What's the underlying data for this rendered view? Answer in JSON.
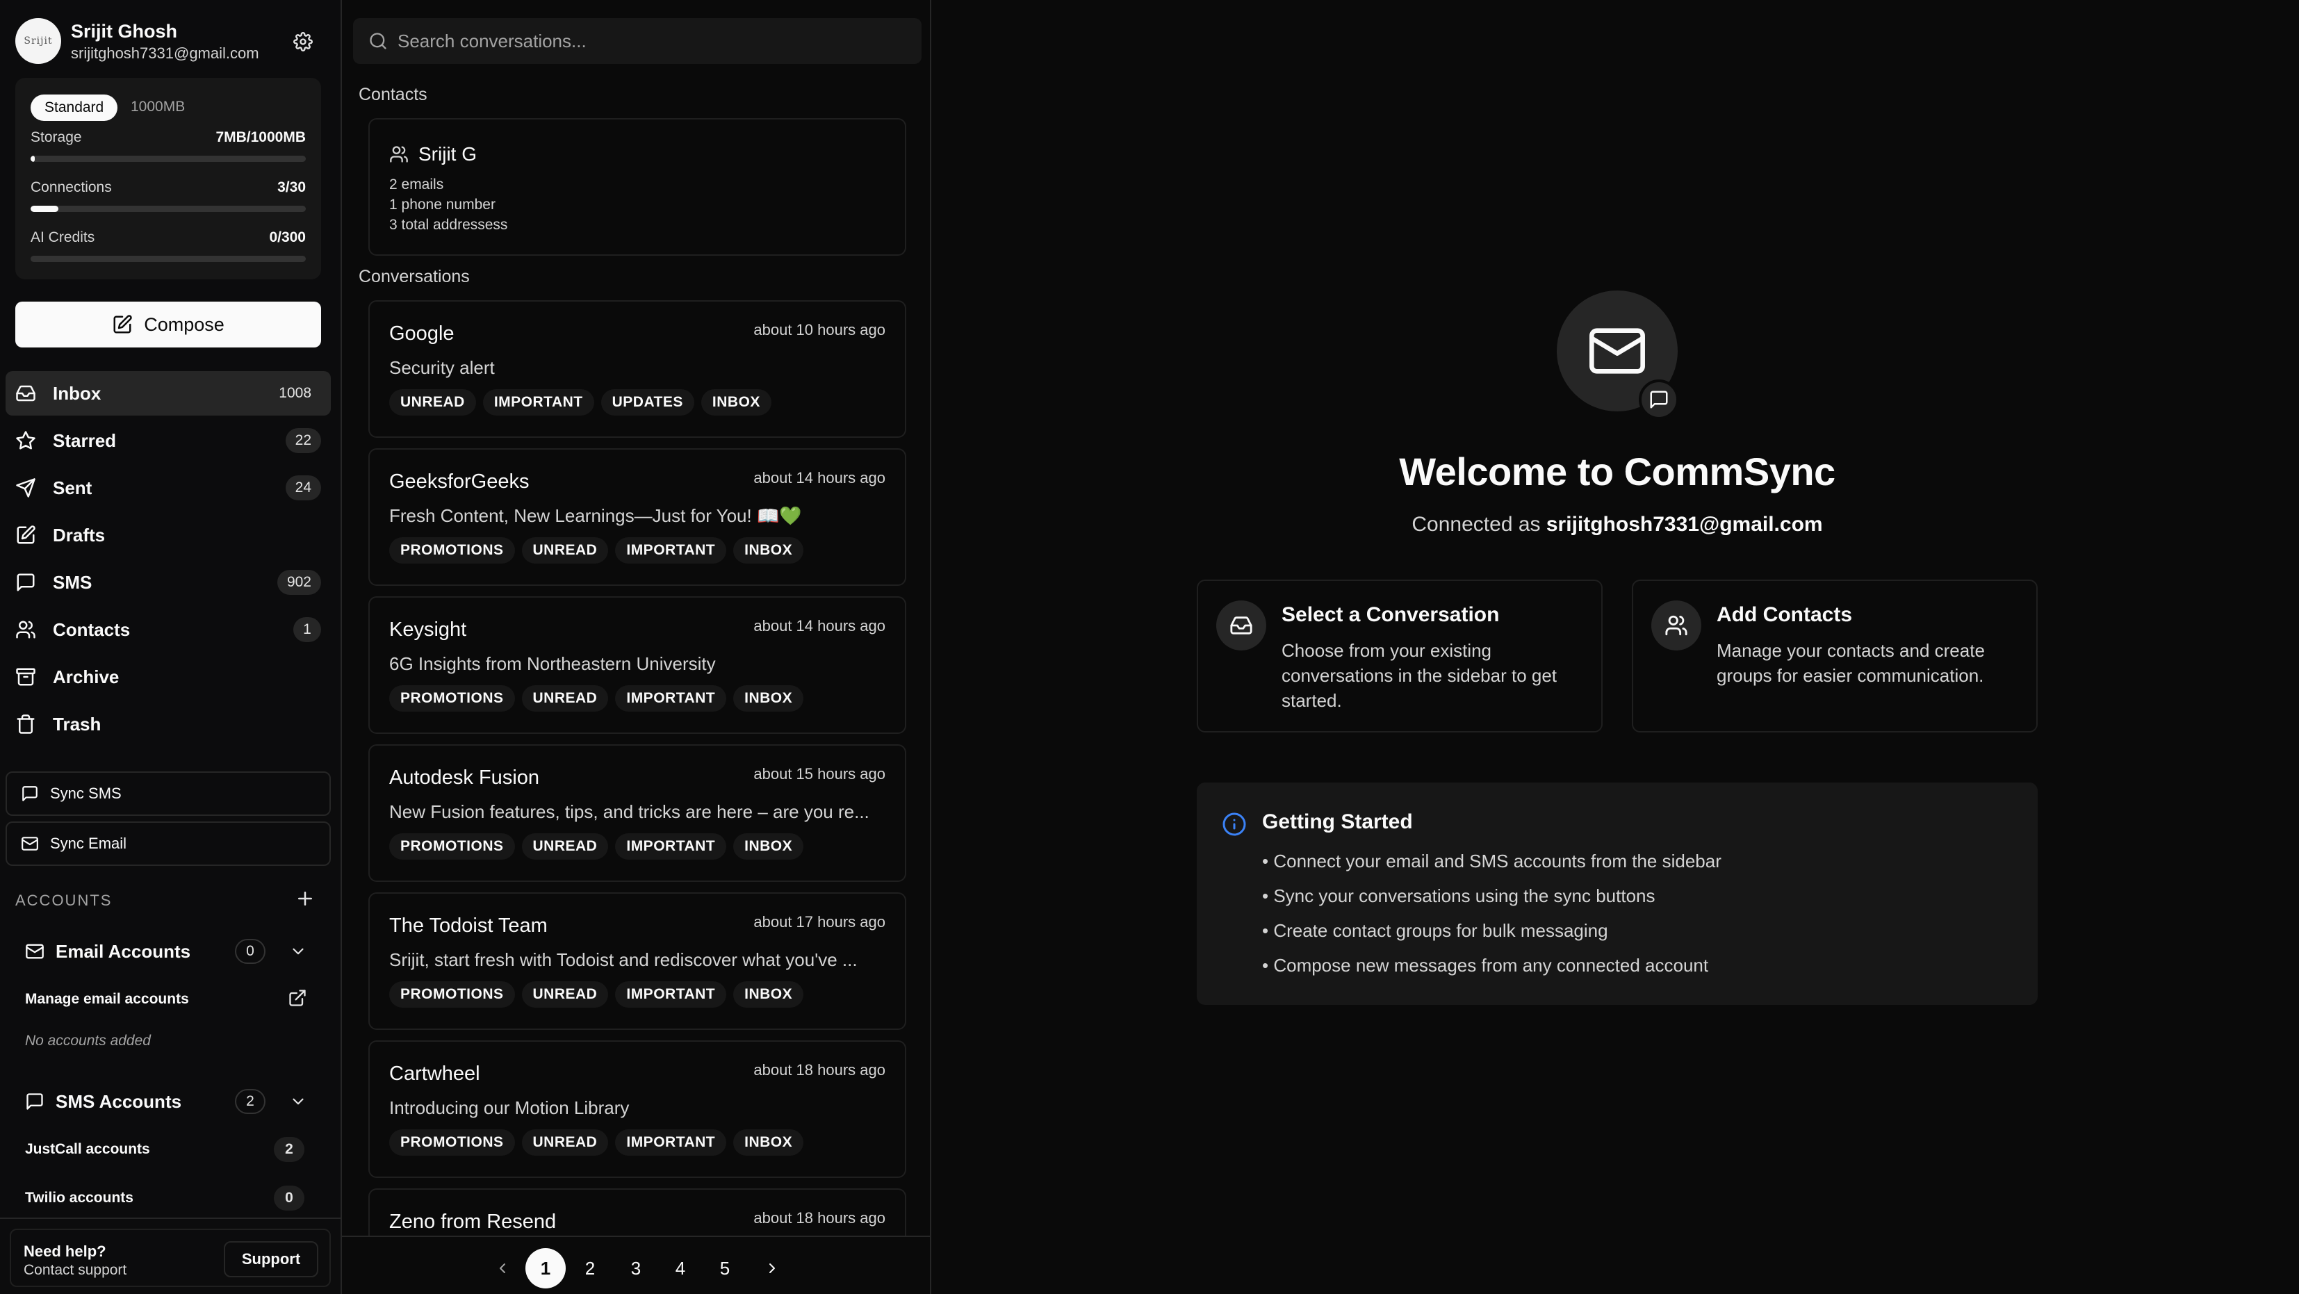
{
  "profile": {
    "name": "Srijit Ghosh",
    "email": "srijitghosh7331@gmail.com",
    "avatar_text": "Srijit"
  },
  "plan": {
    "tier": "Standard",
    "size": "1000MB",
    "storage_label": "Storage",
    "storage_value": "7MB/1000MB",
    "storage_fraction": 0.007,
    "connections_label": "Connections",
    "connections_value": "3/30",
    "connections_fraction": 0.1,
    "ai_label": "AI Credits",
    "ai_value": "0/300",
    "ai_fraction": 0
  },
  "compose_label": "Compose",
  "nav": [
    {
      "label": "Inbox",
      "count": "1008",
      "icon": "inbox-icon"
    },
    {
      "label": "Starred",
      "count": "22",
      "icon": "star-icon"
    },
    {
      "label": "Sent",
      "count": "24",
      "icon": "send-icon"
    },
    {
      "label": "Drafts",
      "count": "",
      "icon": "drafts-icon"
    },
    {
      "label": "SMS",
      "count": "902",
      "icon": "message-icon"
    },
    {
      "label": "Contacts",
      "count": "1",
      "icon": "contacts-icon"
    },
    {
      "label": "Archive",
      "count": "",
      "icon": "archive-icon"
    },
    {
      "label": "Trash",
      "count": "",
      "icon": "trash-icon"
    }
  ],
  "sync": {
    "sms": "Sync SMS",
    "email": "Sync Email"
  },
  "accounts": {
    "heading": "ACCOUNTS",
    "email_label": "Email Accounts",
    "email_count": "0",
    "manage_email": "Manage email accounts",
    "no_accounts": "No accounts added",
    "sms_label": "SMS Accounts",
    "sms_count": "2",
    "justcall_label": "JustCall accounts",
    "justcall_count": "2",
    "twilio_label": "Twilio accounts",
    "twilio_count": "0"
  },
  "help": {
    "title": "Need help?",
    "subtitle": "Contact support",
    "button": "Support"
  },
  "search": {
    "placeholder": "Search conversations..."
  },
  "contacts_heading": "Contacts",
  "contact": {
    "name": "Srijit G",
    "emails": "2 emails",
    "phones": "1 phone number",
    "addresses": "3 total addressess"
  },
  "conversations_heading": "Conversations",
  "conversations": [
    {
      "sender": "Google",
      "time": "about 10 hours ago",
      "subject": "Security alert",
      "tags": [
        "UNREAD",
        "IMPORTANT",
        "UPDATES",
        "INBOX"
      ]
    },
    {
      "sender": "GeeksforGeeks",
      "time": "about 14 hours ago",
      "subject": "Fresh Content, New Learnings—Just for You! 📖💚",
      "tags": [
        "PROMOTIONS",
        "UNREAD",
        "IMPORTANT",
        "INBOX"
      ]
    },
    {
      "sender": "Keysight",
      "time": "about 14 hours ago",
      "subject": "6G Insights from Northeastern University",
      "tags": [
        "PROMOTIONS",
        "UNREAD",
        "IMPORTANT",
        "INBOX"
      ]
    },
    {
      "sender": "Autodesk Fusion",
      "time": "about 15 hours ago",
      "subject": "New Fusion features, tips, and tricks are here – are you re...",
      "tags": [
        "PROMOTIONS",
        "UNREAD",
        "IMPORTANT",
        "INBOX"
      ]
    },
    {
      "sender": "The Todoist Team",
      "time": "about 17 hours ago",
      "subject": "Srijit, start fresh with Todoist and rediscover what you've ...",
      "tags": [
        "PROMOTIONS",
        "UNREAD",
        "IMPORTANT",
        "INBOX"
      ]
    },
    {
      "sender": "Cartwheel",
      "time": "about 18 hours ago",
      "subject": "Introducing our Motion Library",
      "tags": [
        "PROMOTIONS",
        "UNREAD",
        "IMPORTANT",
        "INBOX"
      ]
    },
    {
      "sender": "Zeno from Resend",
      "time": "about 18 hours ago",
      "subject": "",
      "tags": []
    }
  ],
  "pagination": {
    "pages": [
      "1",
      "2",
      "3",
      "4",
      "5"
    ],
    "current": "1"
  },
  "welcome": {
    "title": "Welcome to CommSync",
    "connected_prefix": "Connected as",
    "connected_email": "srijitghosh7331@gmail.com"
  },
  "cards": [
    {
      "title": "Select a Conversation",
      "desc": "Choose from your existing conversations in the sidebar to get started."
    },
    {
      "title": "Add Contacts",
      "desc": "Manage your contacts and create groups for easier communication."
    }
  ],
  "getting_started": {
    "title": "Getting Started",
    "items": [
      "• Connect your email and SMS accounts from the sidebar",
      "• Sync your conversations using the sync buttons",
      "• Create contact groups for bulk messaging",
      "• Compose new messages from any connected account"
    ]
  }
}
